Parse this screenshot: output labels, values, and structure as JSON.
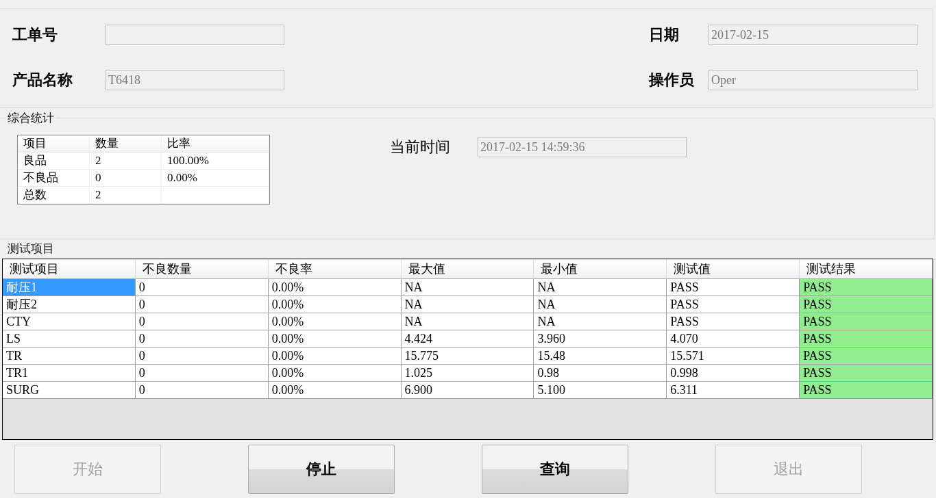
{
  "header": {
    "fields_left": [
      {
        "label": "工单号"
      },
      {
        "label": "产品名称",
        "value": "T6418"
      }
    ],
    "fields_right": [
      {
        "label": "日期",
        "value": "2017-02-15"
      },
      {
        "label": "操作员",
        "value": "Oper"
      }
    ]
  },
  "summary": {
    "title": "综合统计",
    "table": {
      "columns": [
        "项目",
        "数量",
        "比率"
      ],
      "rows": [
        [
          "良品",
          "2",
          "100.00%"
        ],
        [
          "不良品",
          "0",
          "0.00%"
        ],
        [
          "总数",
          "2",
          ""
        ]
      ]
    },
    "time_label": "当前时间",
    "time_value": "2017-02-15 14:59:36"
  },
  "tests": {
    "title": "测试项目",
    "columns": [
      "测试项目",
      "不良数量",
      "不良率",
      "最大值",
      "最小值",
      "测试值",
      "测试结果"
    ],
    "rows": [
      {
        "cells": [
          "耐压1",
          "0",
          "0.00%",
          "NA",
          "NA",
          "PASS",
          "PASS"
        ],
        "selected": true,
        "color": "#90ee90"
      },
      {
        "cells": [
          "耐压2",
          "0",
          "0.00%",
          "NA",
          "NA",
          "PASS",
          "PASS"
        ],
        "selected": false,
        "color": "#90ee90"
      },
      {
        "cells": [
          "CTY",
          "0",
          "0.00%",
          "NA",
          "NA",
          "PASS",
          "PASS"
        ],
        "selected": false,
        "color": "#90ee90"
      },
      {
        "cells": [
          "LS",
          "0",
          "0.00%",
          "4.424",
          "3.960",
          "4.070",
          "PASS"
        ],
        "selected": false,
        "color": "#90ee90"
      },
      {
        "cells": [
          "TR",
          "0",
          "0.00%",
          "15.775",
          "15.48",
          "15.571",
          "PASS"
        ],
        "selected": false,
        "color": "#90ee90"
      },
      {
        "cells": [
          "TR1",
          "0",
          "0.00%",
          "1.025",
          "0.98",
          "0.998",
          "PASS"
        ],
        "selected": false,
        "color": "#90ee90"
      },
      {
        "cells": [
          "SURG",
          "0",
          "0.00%",
          "6.900",
          "5.100",
          "6.311",
          "PASS"
        ],
        "selected": false,
        "color": "#90ee90"
      }
    ]
  },
  "buttons": [
    {
      "label": "开始",
      "disabled": true
    },
    {
      "label": "停止",
      "disabled": false
    },
    {
      "label": "查询",
      "disabled": false
    },
    {
      "label": "退出",
      "disabled": true
    }
  ]
}
